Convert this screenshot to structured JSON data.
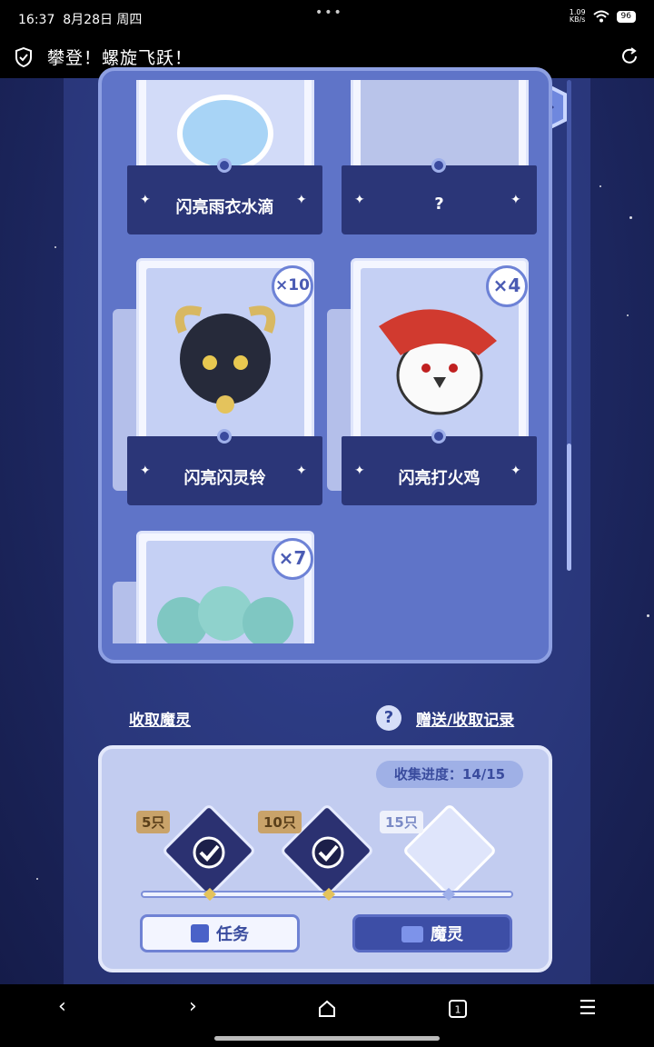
{
  "status_bar": {
    "time": "16:37",
    "date": "8月28日 周四",
    "speed_value": "1.09",
    "speed_unit": "KB/s",
    "battery": "96"
  },
  "browser": {
    "title": "攀登！螺旋飞跃！"
  },
  "top_icons": [
    "home-icon",
    "help-icon",
    "music-icon",
    "share-icon"
  ],
  "cards": [
    {
      "name": "闪亮雨衣水滴",
      "count": ""
    },
    {
      "name": "?",
      "count": ""
    },
    {
      "name": "闪亮闪灵铃",
      "count": "×10"
    },
    {
      "name": "闪亮打火鸡",
      "count": "×4"
    },
    {
      "name": "",
      "count": "×7"
    }
  ],
  "links": {
    "collect": "收取魔灵",
    "record": "赠送/收取记录"
  },
  "collection": {
    "progress_label": "收集进度：",
    "progress": "14/15",
    "milestones": [
      {
        "label": "5只",
        "claimed": true
      },
      {
        "label": "10只",
        "claimed": true
      },
      {
        "label": "15只",
        "claimed": false
      }
    ]
  },
  "buttons": {
    "tasks": "任务",
    "spirits": "魔灵"
  },
  "colors": {
    "panel": "#5f74c8",
    "background": "#1f2a66",
    "card_pocket": "#2b3678",
    "accent": "#a9b8f2"
  }
}
